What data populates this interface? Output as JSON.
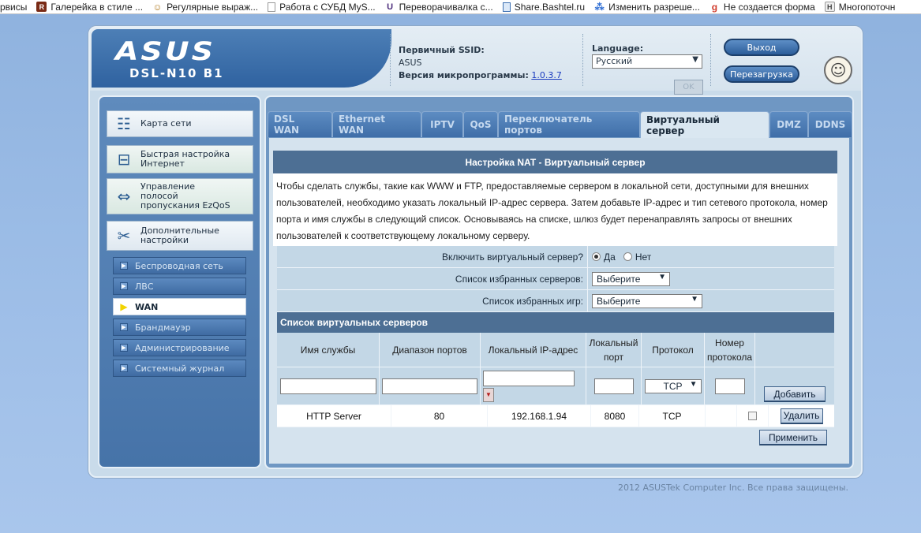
{
  "bookmarks": [
    {
      "label": "рвисы",
      "icon": "page-icon"
    },
    {
      "label": "Галерейка в стиле ...",
      "icon": "r-icon"
    },
    {
      "label": "Регулярные выраж...",
      "icon": "face-icon"
    },
    {
      "label": "Работа с СУБД MyS...",
      "icon": "document-icon"
    },
    {
      "label": "Переворачивалка с...",
      "icon": "u-icon"
    },
    {
      "label": "Share.Bashtel.ru",
      "icon": "page-icon"
    },
    {
      "label": "Изменить разреше...",
      "icon": "dots-icon"
    },
    {
      "label": "Не создается форма",
      "icon": "g-icon"
    },
    {
      "label": "Многопоточн",
      "icon": "h-icon"
    }
  ],
  "header": {
    "brand": "ASUS",
    "model": "DSL-N10 B1",
    "ssid_label": "Первичный SSID:",
    "ssid_value": "ASUS",
    "firmware_label": "Версия микропрограммы:",
    "firmware_value": "1.0.3.7",
    "language_label": "Language:",
    "language_value": "Русский",
    "ok_label": "OK",
    "logout_label": "Выход",
    "reboot_label": "Перезагрузка"
  },
  "left_menu": {
    "main_items": [
      {
        "label": "Карта сети",
        "icon": "network-map-icon"
      },
      {
        "label": "Быстрая настройка Интернет",
        "icon": "router-icon"
      },
      {
        "label": "Управление полосой пропускания EzQoS",
        "icon": "bandwidth-icon"
      },
      {
        "label": "Дополнительные настройки",
        "icon": "wrench-icon"
      }
    ],
    "sub_items": [
      {
        "label": "Беспроводная сеть"
      },
      {
        "label": "ЛВС"
      },
      {
        "label": "WAN"
      },
      {
        "label": "Брандмауэр"
      },
      {
        "label": "Администрирование"
      },
      {
        "label": "Системный журнал"
      }
    ],
    "current_sub": "WAN"
  },
  "tabs": [
    {
      "label": "DSL WAN"
    },
    {
      "label": "Ethernet WAN"
    },
    {
      "label": "IPTV"
    },
    {
      "label": "QoS"
    },
    {
      "label": "Переключатель портов"
    },
    {
      "label": "Виртуальный сервер"
    },
    {
      "label": "DMZ"
    },
    {
      "label": "DDNS"
    }
  ],
  "active_tab": "Виртуальный сервер",
  "nat": {
    "title": "Настройка NAT - Виртуальный сервер",
    "description_lines": [
      "Чтобы сделать службы, такие как WWW и FTP, предоставляемые сервером в локальной сети, доступными для внешних",
      "пользователей, необходимо указать локальный IP-адрес сервера. Затем добавьте IP-адрес и тип сетевого протокола, номер",
      "порта и имя службы в следующий список. Основываясь на списке, шлюз будет перенаправлять запросы от внешних",
      "пользователей к соответствующему локальному серверу."
    ],
    "enable_label": "Включить виртуальный сервер?",
    "enable_yes": "Да",
    "enable_no": "Нет",
    "enable_value": "Да",
    "fav_servers_label": "Список избранных серверов:",
    "fav_servers_value": "Выберите",
    "fav_games_label": "Список избранных игр:",
    "fav_games_value": "Выберите"
  },
  "vs_list": {
    "title": "Список виртуальных серверов",
    "columns": [
      "Имя службы",
      "Диапазон портов",
      "Локальный IP-адрес",
      "Локальный порт",
      "Протокол",
      "Номер протокола"
    ],
    "input_protocol": "TCP",
    "add_label": "Добавить",
    "rows": [
      {
        "service": "HTTP Server",
        "ports": "80",
        "ip": "192.168.1.94",
        "local_port": "8080",
        "protocol": "TCP",
        "proto_num": ""
      }
    ],
    "delete_label": "Удалить",
    "apply_label": "Применить"
  },
  "footer": "2012 ASUSTek Computer Inc. Все права защищены."
}
